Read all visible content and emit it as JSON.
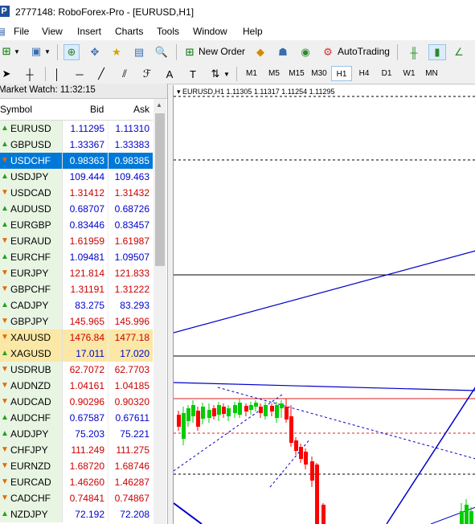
{
  "window": {
    "title": "2777148: RoboForex-Pro - [EURUSD,H1]"
  },
  "menu": [
    "File",
    "View",
    "Insert",
    "Charts",
    "Tools",
    "Window",
    "Help"
  ],
  "toolbar": {
    "new_order": "New Order",
    "autotrading": "AutoTrading"
  },
  "timeframes": [
    "M1",
    "M5",
    "M15",
    "M30",
    "H1",
    "H4",
    "D1",
    "W1",
    "MN"
  ],
  "active_timeframe": "H1",
  "market_watch": {
    "title": "Market Watch: 11:32:15",
    "col_symbol": "Symbol",
    "col_bid": "Bid",
    "col_ask": "Ask",
    "rows": [
      {
        "symbol": "EURUSD",
        "bid": "1.11295",
        "ask": "1.11310",
        "dir": "up",
        "color": "#0000cc"
      },
      {
        "symbol": "GBPUSD",
        "bid": "1.33367",
        "ask": "1.33383",
        "dir": "up",
        "color": "#0000cc"
      },
      {
        "symbol": "USDCHF",
        "bid": "0.98363",
        "ask": "0.98385",
        "dir": "down",
        "color": "#ffffff",
        "selected": true
      },
      {
        "symbol": "USDJPY",
        "bid": "109.444",
        "ask": "109.463",
        "dir": "up",
        "color": "#0000cc"
      },
      {
        "symbol": "USDCAD",
        "bid": "1.31412",
        "ask": "1.31432",
        "dir": "down",
        "color": "#cc0000"
      },
      {
        "symbol": "AUDUSD",
        "bid": "0.68707",
        "ask": "0.68726",
        "dir": "up",
        "color": "#0000cc"
      },
      {
        "symbol": "EURGBP",
        "bid": "0.83446",
        "ask": "0.83457",
        "dir": "up",
        "color": "#0000cc"
      },
      {
        "symbol": "EURAUD",
        "bid": "1.61959",
        "ask": "1.61987",
        "dir": "down",
        "color": "#cc0000"
      },
      {
        "symbol": "EURCHF",
        "bid": "1.09481",
        "ask": "1.09507",
        "dir": "up",
        "color": "#0000cc"
      },
      {
        "symbol": "EURJPY",
        "bid": "121.814",
        "ask": "121.833",
        "dir": "down",
        "color": "#cc0000"
      },
      {
        "symbol": "GBPCHF",
        "bid": "1.31191",
        "ask": "1.31222",
        "dir": "down",
        "color": "#cc0000"
      },
      {
        "symbol": "CADJPY",
        "bid": "83.275",
        "ask": "83.293",
        "dir": "up",
        "color": "#0000cc"
      },
      {
        "symbol": "GBPJPY",
        "bid": "145.965",
        "ask": "145.996",
        "dir": "down",
        "color": "#cc0000"
      },
      {
        "symbol": "XAUUSD",
        "bid": "1476.84",
        "ask": "1477.18",
        "dir": "down",
        "color": "#cc0000",
        "highlight": true
      },
      {
        "symbol": "XAGUSD",
        "bid": "17.011",
        "ask": "17.020",
        "dir": "up",
        "color": "#0000cc",
        "highlight": true
      },
      {
        "symbol": "USDRUB",
        "bid": "62.7072",
        "ask": "62.7703",
        "dir": "down",
        "color": "#cc0000"
      },
      {
        "symbol": "AUDNZD",
        "bid": "1.04161",
        "ask": "1.04185",
        "dir": "down",
        "color": "#cc0000"
      },
      {
        "symbol": "AUDCAD",
        "bid": "0.90296",
        "ask": "0.90320",
        "dir": "down",
        "color": "#cc0000"
      },
      {
        "symbol": "AUDCHF",
        "bid": "0.67587",
        "ask": "0.67611",
        "dir": "up",
        "color": "#0000cc"
      },
      {
        "symbol": "AUDJPY",
        "bid": "75.203",
        "ask": "75.221",
        "dir": "up",
        "color": "#0000cc"
      },
      {
        "symbol": "CHFJPY",
        "bid": "111.249",
        "ask": "111.275",
        "dir": "down",
        "color": "#cc0000"
      },
      {
        "symbol": "EURNZD",
        "bid": "1.68720",
        "ask": "1.68746",
        "dir": "down",
        "color": "#cc0000"
      },
      {
        "symbol": "EURCAD",
        "bid": "1.46260",
        "ask": "1.46287",
        "dir": "down",
        "color": "#cc0000"
      },
      {
        "symbol": "CADCHF",
        "bid": "0.74841",
        "ask": "0.74867",
        "dir": "down",
        "color": "#cc0000"
      },
      {
        "symbol": "NZDJPY",
        "bid": "72.192",
        "ask": "72.208",
        "dir": "up",
        "color": "#0000cc"
      }
    ]
  },
  "chart": {
    "caption": "EURUSD,H1  1.11305 1.11317 1.11254 1.11295",
    "up_color": "#00cc00",
    "down_color": "#ff0000",
    "line_color": "#0000cc"
  }
}
